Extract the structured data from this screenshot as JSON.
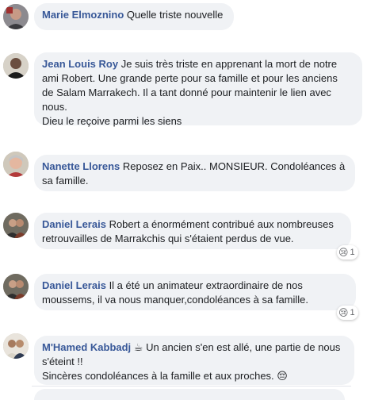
{
  "comments": [
    {
      "author": "Marie Elmoznino",
      "lines": [
        "Quelle triste nouvelle"
      ]
    },
    {
      "author": "Jean Louis Roy",
      "lines": [
        "Je suis très triste en apprenant la mort de notre",
        "ami Robert. Une grande perte pour sa famille et pour les anciens",
        "de Salam Marrakech. Il a tant donné pour maintenir le lien avec",
        "nous.",
        "Dieu le reçoive parmi les siens"
      ]
    },
    {
      "author": "Nanette Llorens",
      "lines": [
        "Reposez en Paix.. MONSIEUR. Condoléances à",
        "sa famille."
      ]
    },
    {
      "author": "Daniel Lerais",
      "lines": [
        "Robert a énormément contribué aux nombreuses",
        "retrouvailles de Marrakchis qui s'étaient perdus de vue."
      ],
      "reaction": {
        "emoji": "😢",
        "count": "1"
      }
    },
    {
      "author": "Daniel Lerais",
      "lines": [
        "Il a été un animateur extraordinaire de nos",
        "moussems, il va nous manquer,condoléances à sa famille."
      ],
      "reaction": {
        "emoji": "😢",
        "count": "1"
      }
    },
    {
      "author": "M'Hamed Kabbadj",
      "author_emoji": "☕",
      "lines": [
        "Un ancien s'en est allé, une partie de nous",
        "s'éteint !!",
        "Sincères condoléances à la famille et aux proches."
      ],
      "trailing_emoji": "😔"
    }
  ]
}
